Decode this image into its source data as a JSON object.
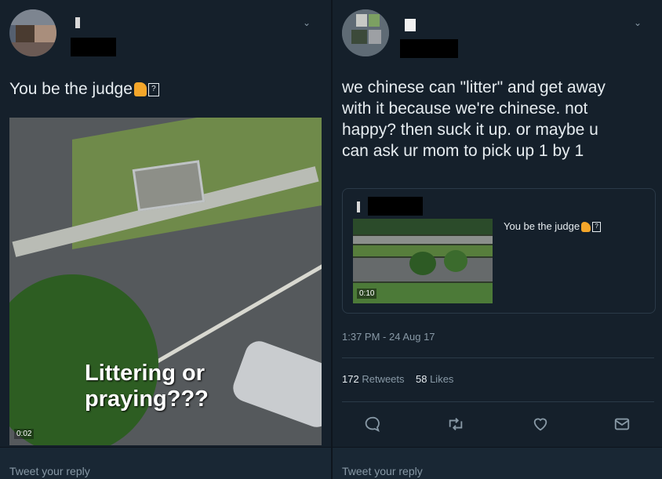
{
  "left": {
    "tweet_text": "You be the judge",
    "emoji_glyph": "?",
    "video": {
      "overlay_line1": "Littering or",
      "overlay_line2": "praying???",
      "duration": "0:02"
    },
    "reply_placeholder": "Tweet your reply"
  },
  "right": {
    "tweet_lines": [
      "we chinese can \"litter\" and get away",
      "with it because we're chinese. not",
      "happy? then suck it up. or maybe u",
      "can ask ur mom to pick up 1 by 1"
    ],
    "quote": {
      "text": "You be the judge",
      "emoji_glyph": "?",
      "duration": "0:10"
    },
    "timestamp": "1:37 PM - 24 Aug 17",
    "retweets_count": "172",
    "retweets_label": "Retweets",
    "likes_count": "58",
    "likes_label": "Likes",
    "reply_placeholder": "Tweet your reply"
  },
  "icons": {
    "reply": "reply-icon",
    "retweet": "retweet-icon",
    "like": "heart-icon",
    "dm": "envelope-icon"
  },
  "colors": {
    "background": "#15202b",
    "text": "#e6ecf0",
    "muted": "#8899a6"
  }
}
